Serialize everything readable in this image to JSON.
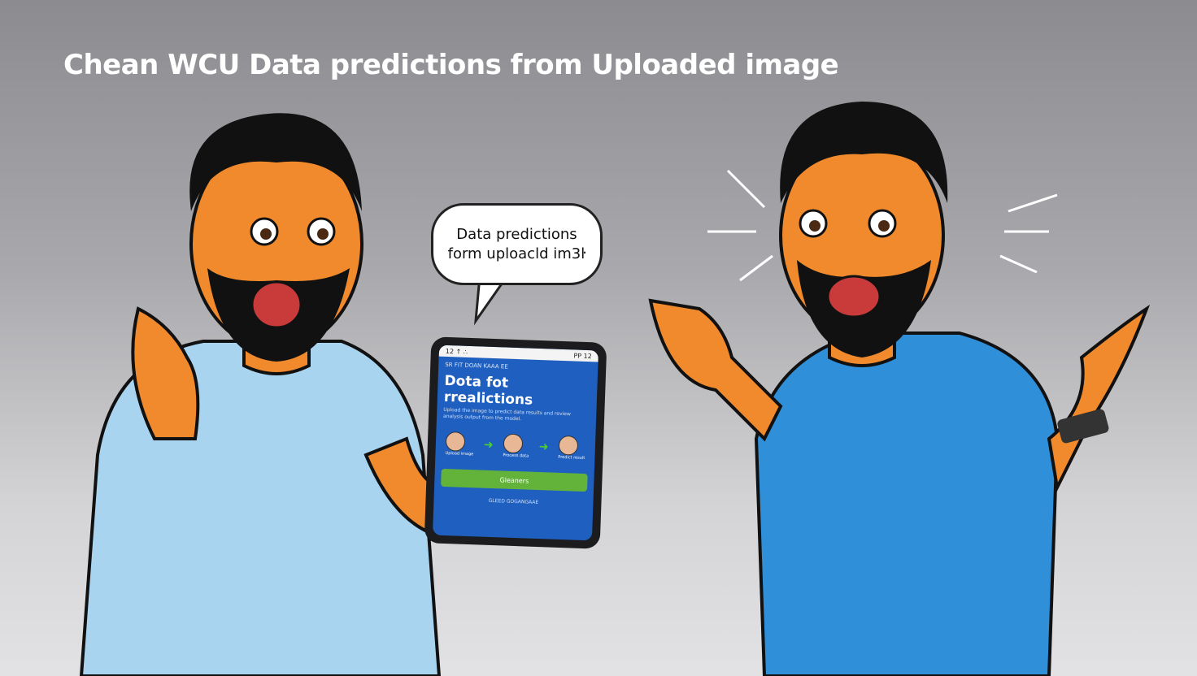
{
  "title": "Chean WCU Data predictions from Uploaded image",
  "speech_bubble": {
    "line1": "Data predictions",
    "line2": "form uploacld im3ŀ"
  },
  "tablet": {
    "status_left": "12 ↑ ∴",
    "status_right": "PP 12",
    "subheading": "SR FIT DOAN KAAA EE",
    "heading": "Dota fot rrealictions",
    "description": "Upload the image to predict data results and review analysis output from the model.",
    "steps": [
      {
        "label": "Upload image"
      },
      {
        "label": "Process data"
      },
      {
        "label": "Predict result"
      }
    ],
    "button_label": "Gleaners",
    "footer": "GLEED GOGANGAAE"
  },
  "colors": {
    "left_shirt": "#a9d4f0",
    "right_shirt": "#2f8fd8",
    "skin": "#f08a2c",
    "screen": "#1f5fbf",
    "button": "#63b33b"
  }
}
